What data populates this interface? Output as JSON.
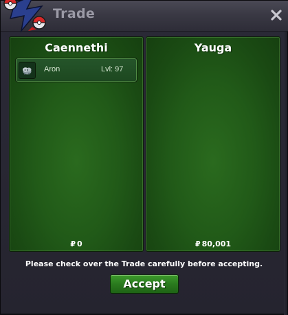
{
  "window": {
    "title": "Trade",
    "logo_icon": "trade-pokeball-logo-icon",
    "close_icon": "close-x-icon"
  },
  "colors": {
    "panel_green": "#215a18",
    "accept_green": "#2a7a1e",
    "title_text": "#9b9aa6",
    "window_bg": "#2b2a37"
  },
  "trade": {
    "left": {
      "name": "Caennethi",
      "pokemon": [
        {
          "name": "Aron",
          "level": "Lvl: 97",
          "icon": "aron-sprite-icon"
        }
      ],
      "money": "0",
      "money_icon": "₽"
    },
    "right": {
      "name": "Yauga",
      "pokemon": [],
      "money": "80,001",
      "money_icon": "₽"
    }
  },
  "notice": "Please check over the Trade carefully before accepting.",
  "accept_label": "Accept"
}
